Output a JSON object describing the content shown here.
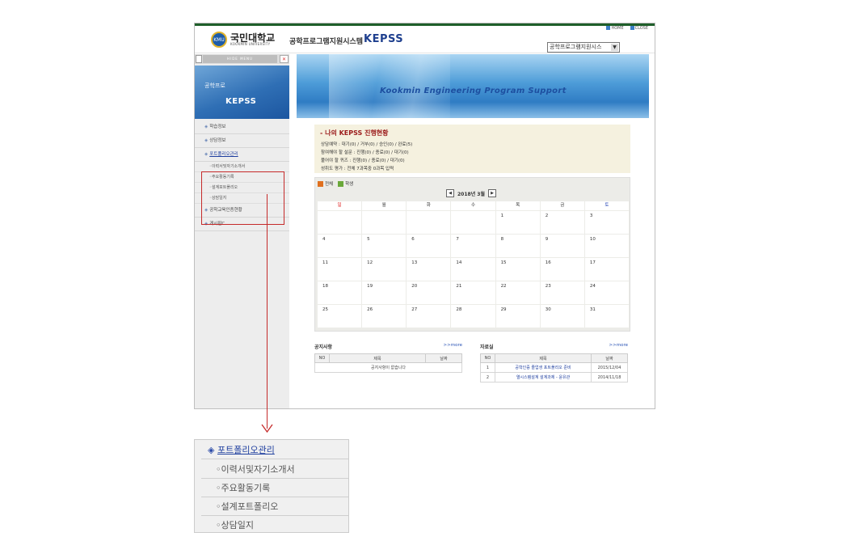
{
  "header": {
    "logo_badge": "KMU",
    "logo_kr": "국민대학교",
    "logo_en": "KOOKMIN UNIVERSITY",
    "system_name": "공학프로그램지원시스템",
    "app_title": "KEPSS",
    "home_link": "HOME",
    "close_link": "CLOSE",
    "select_value": "공학프로그램지원시스"
  },
  "sidebar": {
    "hide_menu": "HIDE MENU",
    "banner_small": "공학프로",
    "banner_big": "KEPSS",
    "items": [
      {
        "label": "학습정보"
      },
      {
        "label": "상담정보"
      },
      {
        "label": "포트폴리오관리"
      },
      {
        "label": "공학교육인증현황"
      },
      {
        "label": "게시판C"
      }
    ],
    "subitems": [
      {
        "label": "이력서및자기소개서"
      },
      {
        "label": "주요활동기록"
      },
      {
        "label": "설계포트폴리오"
      },
      {
        "label": "상담일지"
      }
    ]
  },
  "banner": {
    "text": "Kookmin Engineering Program Support"
  },
  "status": {
    "title": "- 나의 KEPSS 진행현황",
    "lines": [
      "상담예약 : 대기(0) / 거부(0) / 승인(0) / 완료(5)",
      "참여해야 할 설문 : 진행(0) / 종료(0) / 대기(0)",
      "풀어야 할 퀴즈 : 진행(0) / 종료(0) / 대기(0)",
      "성취도 평가 : 전체 7과목중 0과목 입력"
    ]
  },
  "calendar": {
    "legend_all": "전체",
    "legend_student": "학생",
    "month": "2018년 3월",
    "weekdays": [
      "일",
      "월",
      "화",
      "수",
      "목",
      "금",
      "토"
    ],
    "days": [
      "",
      "",
      "",
      "",
      "1",
      "2",
      "3",
      "4",
      "5",
      "6",
      "7",
      "8",
      "9",
      "10",
      "11",
      "12",
      "13",
      "14",
      "15",
      "16",
      "17",
      "18",
      "19",
      "20",
      "21",
      "22",
      "23",
      "24",
      "25",
      "26",
      "27",
      "28",
      "29",
      "30",
      "31"
    ]
  },
  "notice": {
    "title": "공지사항",
    "more": ">>more",
    "headers": [
      "NO",
      "제목",
      "날짜"
    ],
    "empty": "공지사항이 없습니다"
  },
  "archive": {
    "title": "자료실",
    "more": ">>more",
    "headers": [
      "NO",
      "제목",
      "날짜"
    ],
    "rows": [
      {
        "no": "1",
        "title": "공학인증 졸업생 포트폴리오 준비",
        "date": "2015/12/04"
      },
      {
        "no": "2",
        "title": "열시스템설계 설계과제 - 윤유관",
        "date": "2014/11/18"
      }
    ]
  },
  "zoom": {
    "items": [
      {
        "label": "포트폴리오관리"
      },
      {
        "label": "이력서및자기소개서"
      },
      {
        "label": "주요활동기록"
      },
      {
        "label": "설계포트폴리오"
      },
      {
        "label": "상담일지"
      }
    ]
  }
}
